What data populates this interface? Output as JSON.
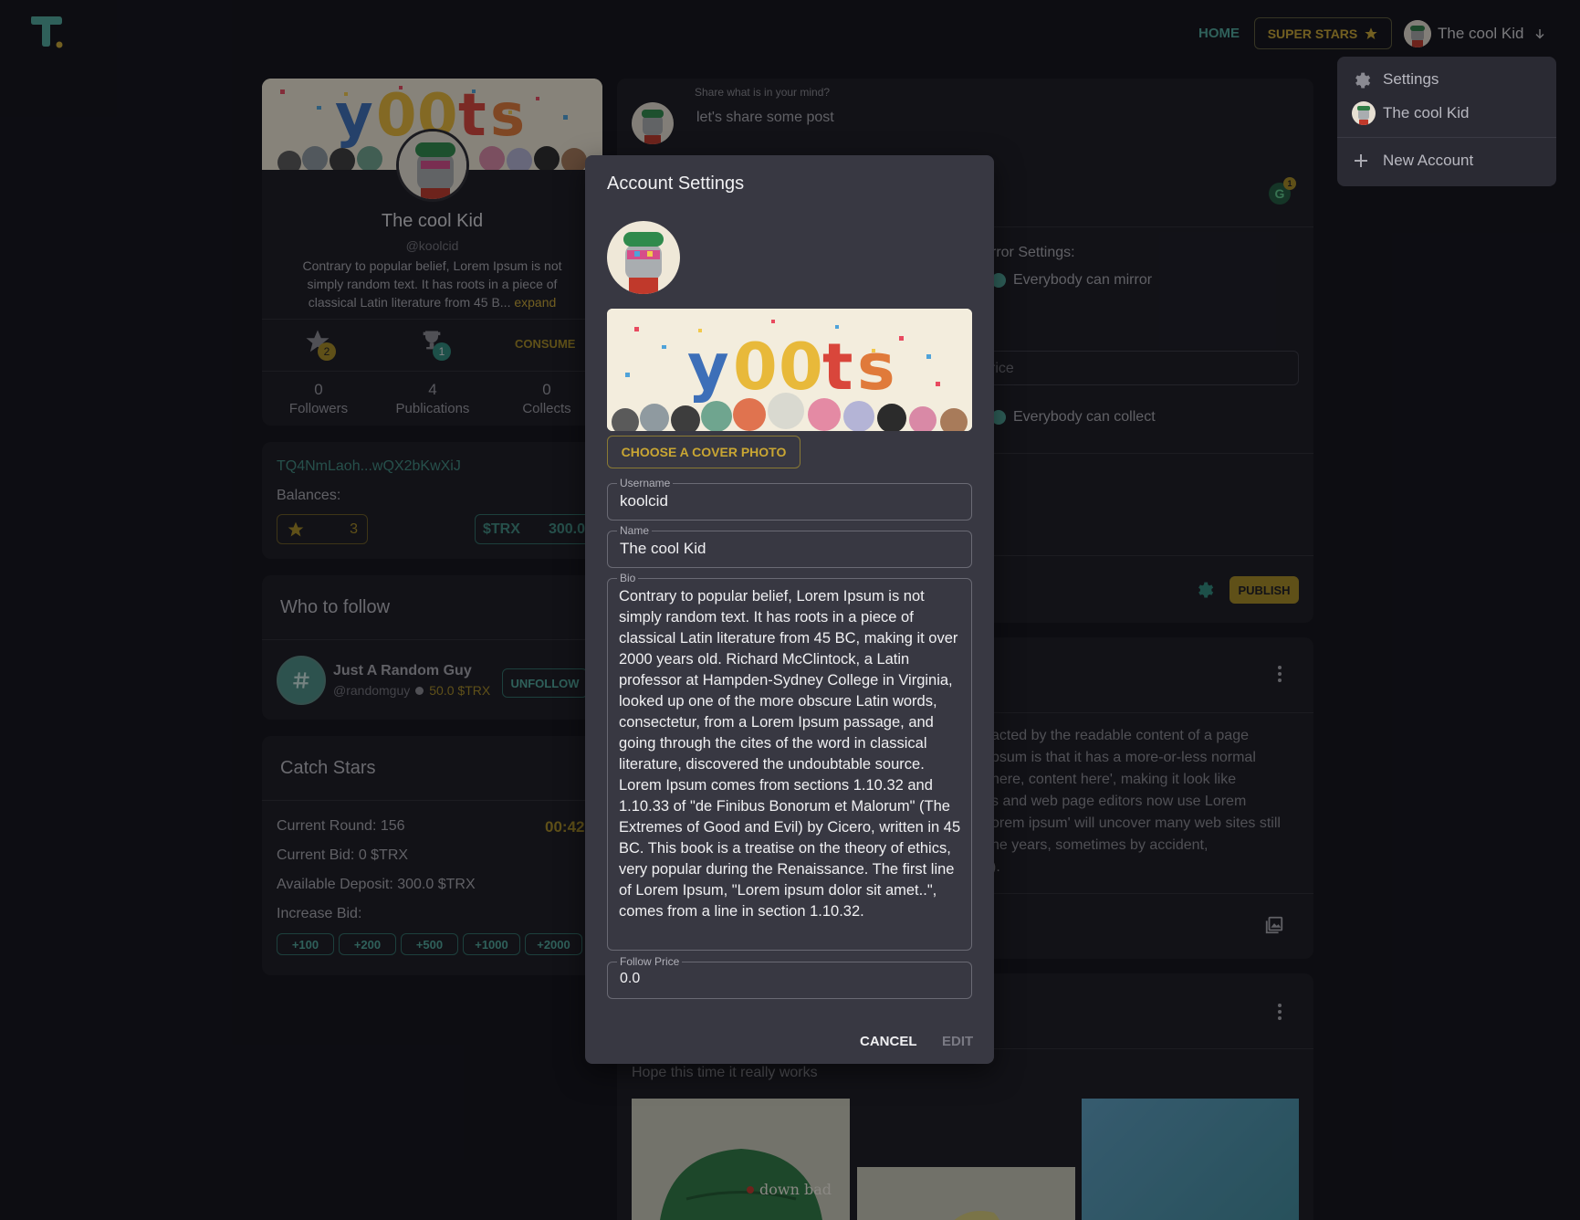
{
  "header": {
    "logo_text": "T",
    "nav_home": "HOME",
    "nav_superstars": "SUPER STARS",
    "user_name": "The cool Kid"
  },
  "user_menu": {
    "items": [
      "Settings",
      "The cool Kid",
      "New Account"
    ]
  },
  "profile": {
    "cover_text": "y00ts",
    "name": "The cool Kid",
    "handle": "@koolcid",
    "bio_preview": "Contrary to popular belief, Lorem Ipsum is not simply random text. It has roots in a piece of classical Latin literature from 45 B...",
    "expand": "expand",
    "star_badge": "2",
    "trophy_badge": "1",
    "consume": "CONSUME",
    "stats": [
      {
        "value": "0",
        "label": "Followers"
      },
      {
        "value": "4",
        "label": "Publications"
      },
      {
        "value": "0",
        "label": "Collects"
      }
    ]
  },
  "wallet": {
    "address": "TQ4NmLaoh...wQX2bKwXiJ",
    "balances_label": "Balances:",
    "star_balance": "3",
    "trx_label": "$TRX",
    "trx_balance": "300.0"
  },
  "who_to_follow": {
    "title": "Who to follow",
    "user_name": "Just A Random Guy",
    "user_handle": "@randomguy",
    "price": "50.0 $TRX",
    "button": "UNFOLLOW"
  },
  "catch_stars": {
    "title": "Catch Stars",
    "round": "Current Round: 156",
    "timer": "00:42",
    "bid": "Current Bid: 0 $TRX",
    "deposit": "Available Deposit: 300.0 $TRX",
    "increase": "Increase Bid:",
    "chips": [
      "+100",
      "+200",
      "+500",
      "+1000",
      "+2000"
    ]
  },
  "composer": {
    "label": "Share what is in your mind?",
    "value": "let's share some post",
    "grammarly_badge": "1",
    "mirror_settings": "rror Settings:",
    "everybody_mirror": "Everybody can mirror",
    "price_placeholder": "rice",
    "everybody_collect": "Everybody can collect",
    "publish": "PUBLISH"
  },
  "feed": {
    "post_text_lines": [
      "acted by the readable content of a page",
      "psum is that it has a more-or-less normal",
      "here, content here', making it look like",
      "s and web page editors now use Lorem",
      "orem ipsum' will uncover many web sites still",
      "he years, sometimes by accident,",
      ")."
    ],
    "post2_text": "Hope this time it really works",
    "hat_text": "down bad"
  },
  "modal": {
    "title": "Account Settings",
    "choose_cover": "CHOOSE A COVER PHOTO",
    "username_label": "Username",
    "username_value": "koolcid",
    "name_label": "Name",
    "name_value": "The cool Kid",
    "bio_label": "Bio",
    "bio_value": "Contrary to popular belief, Lorem Ipsum is not simply random text. It has roots in a piece of classical Latin literature from 45 BC, making it over 2000 years old. Richard McClintock, a Latin professor at Hampden-Sydney College in Virginia, looked up one of the more obscure Latin words, consectetur, from a Lorem Ipsum passage, and going through the cites of the word in classical literature, discovered the undoubtable source. Lorem Ipsum comes from sections 1.10.32 and 1.10.33 of \"de Finibus Bonorum et Malorum\" (The Extremes of Good and Evil) by Cicero, written in 45 BC. This book is a treatise on the theory of ethics, very popular during the Renaissance. The first line of Lorem Ipsum, \"Lorem ipsum dolor sit amet..\", comes from a line in section 1.10.32.",
    "follow_price_label": "Follow Price",
    "follow_price_value": "0.0",
    "cancel": "CANCEL",
    "edit": "EDIT"
  },
  "colors": {
    "accent_teal": "#4fa89c",
    "accent_gold": "#c9a633",
    "background": "#121218",
    "card": "#1b1b22",
    "modal": "#383842"
  }
}
